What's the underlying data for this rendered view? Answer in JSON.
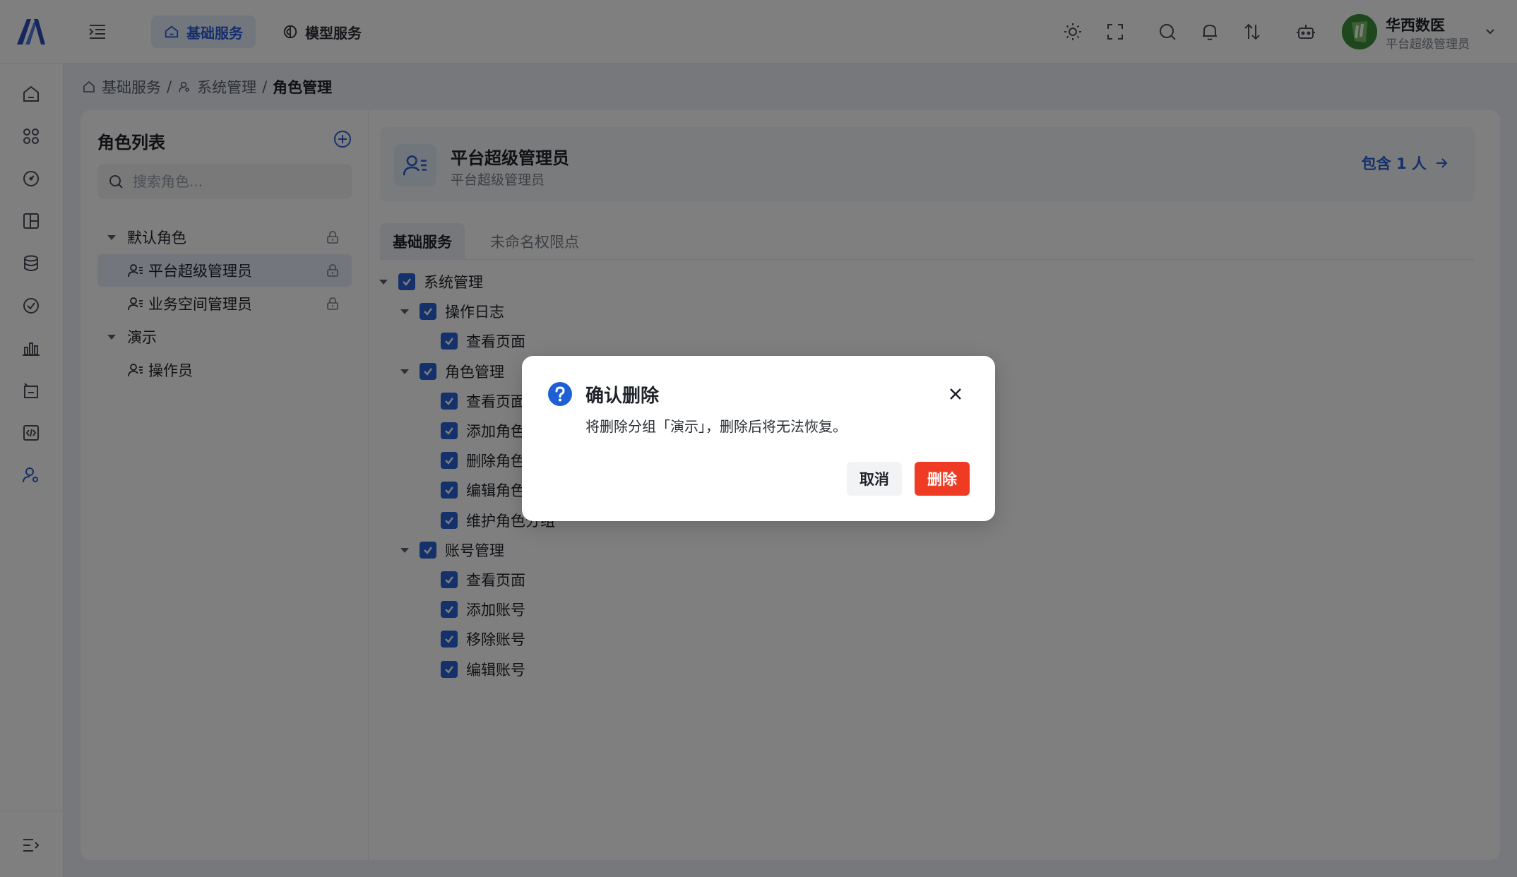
{
  "header": {
    "nav_tabs": [
      {
        "label": "基础服务",
        "icon": "home-icon",
        "active": true
      },
      {
        "label": "模型服务",
        "icon": "brain-icon",
        "active": false
      }
    ],
    "top_icons": [
      "sun-icon",
      "fullscreen-icon",
      "search-icon",
      "bell-icon",
      "transfer-icon",
      "robot-icon"
    ],
    "user": {
      "name": "华西数医",
      "role": "平台超级管理员"
    }
  },
  "rail": {
    "icons": [
      "home-icon",
      "apps-icon",
      "dashboard-icon",
      "layout-icon",
      "database-icon",
      "check-circle-icon",
      "bar-chart-icon",
      "calendar-icon",
      "code-icon",
      "user-settings-icon"
    ],
    "collapse_icon": "collapse-icon"
  },
  "breadcrumb": {
    "items": [
      "基础服务",
      "系统管理"
    ],
    "separator": "/",
    "current": "角色管理"
  },
  "role_list": {
    "title": "角色列表",
    "search_placeholder": "搜索角色...",
    "groups": [
      {
        "name": "默认角色",
        "locked": true,
        "roles": [
          {
            "name": "平台超级管理员",
            "locked": true,
            "selected": true
          },
          {
            "name": "业务空间管理员",
            "locked": true,
            "selected": false
          }
        ]
      },
      {
        "name": "演示",
        "locked": false,
        "roles": [
          {
            "name": "操作员",
            "locked": false,
            "selected": false
          }
        ]
      }
    ]
  },
  "role_detail": {
    "title": "平台超级管理员",
    "subtitle": "平台超级管理员",
    "members_link": "包含 1 人",
    "tabs": [
      {
        "label": "基础服务",
        "active": true
      },
      {
        "label": "未命名权限点",
        "active": false
      }
    ],
    "permissions": [
      {
        "label": "系统管理",
        "level": 0,
        "expandable": true,
        "checked": true
      },
      {
        "label": "操作日志",
        "level": 1,
        "expandable": true,
        "checked": true
      },
      {
        "label": "查看页面",
        "level": 2,
        "expandable": false,
        "checked": true
      },
      {
        "label": "角色管理",
        "level": 1,
        "expandable": true,
        "checked": true
      },
      {
        "label": "查看页面",
        "level": 2,
        "expandable": false,
        "checked": true
      },
      {
        "label": "添加角色",
        "level": 2,
        "expandable": false,
        "checked": true
      },
      {
        "label": "删除角色",
        "level": 2,
        "expandable": false,
        "checked": true
      },
      {
        "label": "编辑角色",
        "level": 2,
        "expandable": false,
        "checked": true
      },
      {
        "label": "维护角色分组",
        "level": 2,
        "expandable": false,
        "checked": true
      },
      {
        "label": "账号管理",
        "level": 1,
        "expandable": true,
        "checked": true
      },
      {
        "label": "查看页面",
        "level": 2,
        "expandable": false,
        "checked": true
      },
      {
        "label": "添加账号",
        "level": 2,
        "expandable": false,
        "checked": true
      },
      {
        "label": "移除账号",
        "level": 2,
        "expandable": false,
        "checked": true
      },
      {
        "label": "编辑账号",
        "level": 2,
        "expandable": false,
        "checked": true
      }
    ]
  },
  "dialog": {
    "title": "确认删除",
    "message": "将删除分组「演示」，删除后将无法恢复。",
    "cancel_label": "取消",
    "confirm_label": "删除",
    "icon": "question-circle-icon"
  },
  "colors": {
    "primary": "#2a5fd6",
    "danger": "#f03b24",
    "overlay": "rgba(0,0,0,0.5)"
  }
}
